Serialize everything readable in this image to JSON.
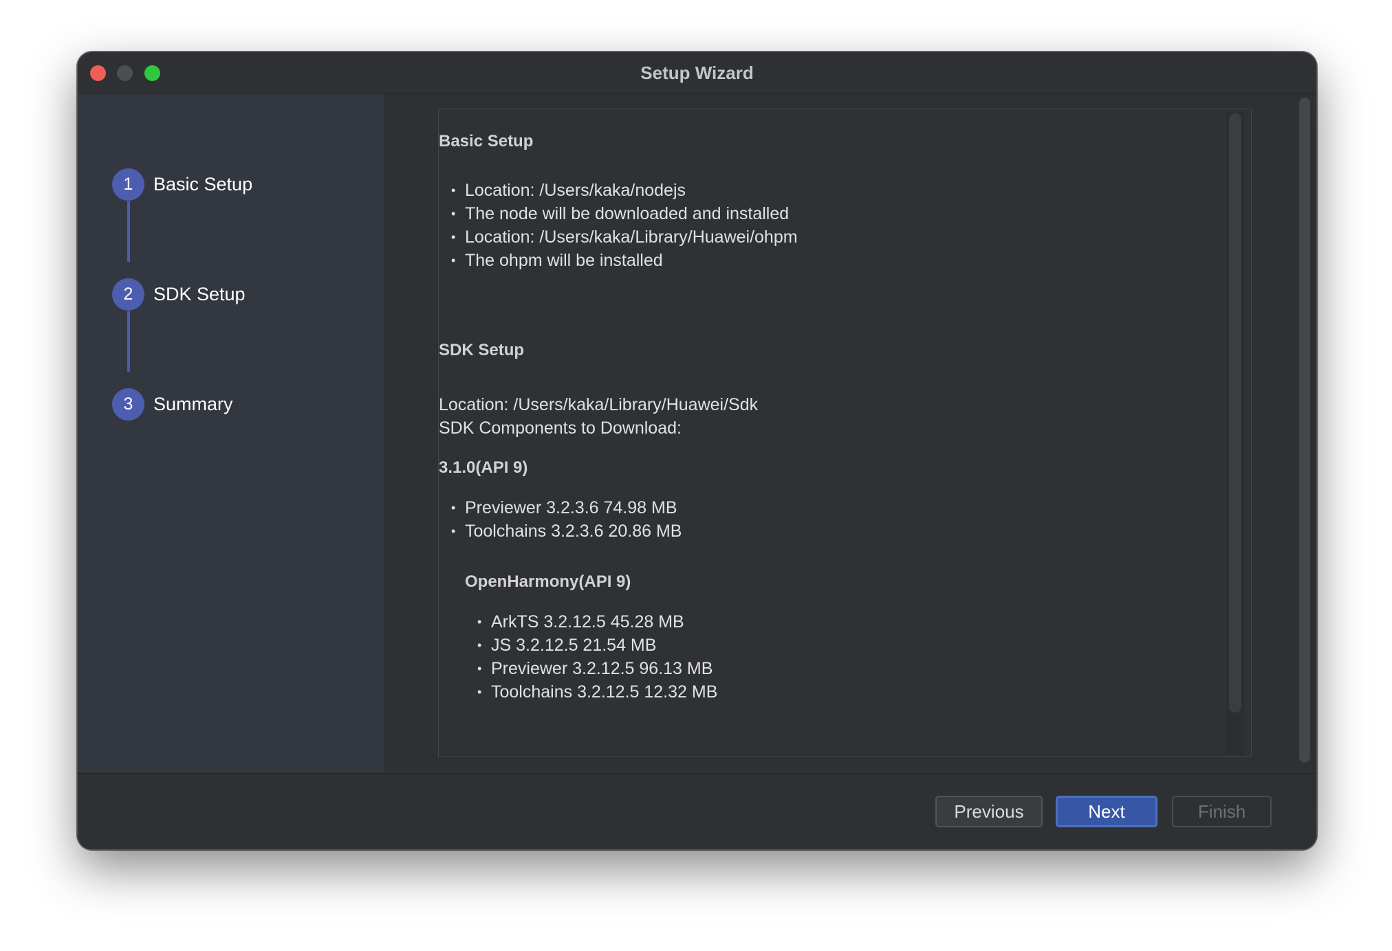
{
  "window": {
    "title": "Setup Wizard"
  },
  "steps": [
    {
      "number": "1",
      "label": "Basic Setup"
    },
    {
      "number": "2",
      "label": "SDK Setup"
    },
    {
      "number": "3",
      "label": "Summary"
    }
  ],
  "summary": {
    "basic_setup": {
      "title": "Basic Setup",
      "items": [
        "Location: /Users/kaka/nodejs",
        "The node will be downloaded and installed",
        "Location: /Users/kaka/Library/Huawei/ohpm",
        "The ohpm will be installed"
      ]
    },
    "sdk_setup": {
      "title": "SDK Setup",
      "location": "Location: /Users/kaka/Library/Huawei/Sdk",
      "components_label": "SDK Components to Download:",
      "api_group": {
        "title": "3.1.0(API 9)",
        "items": [
          "Previewer  3.2.3.6  74.98 MB",
          "Toolchains  3.2.3.6  20.86 MB"
        ]
      },
      "openharmony_group": {
        "title": "OpenHarmony(API 9)",
        "items": [
          "ArkTS  3.2.12.5  45.28 MB",
          "JS  3.2.12.5  21.54 MB",
          "Previewer  3.2.12.5  96.13 MB",
          "Toolchains  3.2.12.5  12.32 MB"
        ]
      }
    }
  },
  "buttons": {
    "previous": "Previous",
    "next": "Next",
    "finish": "Finish"
  },
  "icons": {
    "traffic_close": "close-icon",
    "traffic_minimize": "minimize-icon",
    "traffic_zoom": "zoom-icon",
    "bullet": "•"
  },
  "colors": {
    "accent": "#4d5db0",
    "primary_button": "#3657a6",
    "background": "#2f3033",
    "sidebar": "#33373f"
  }
}
